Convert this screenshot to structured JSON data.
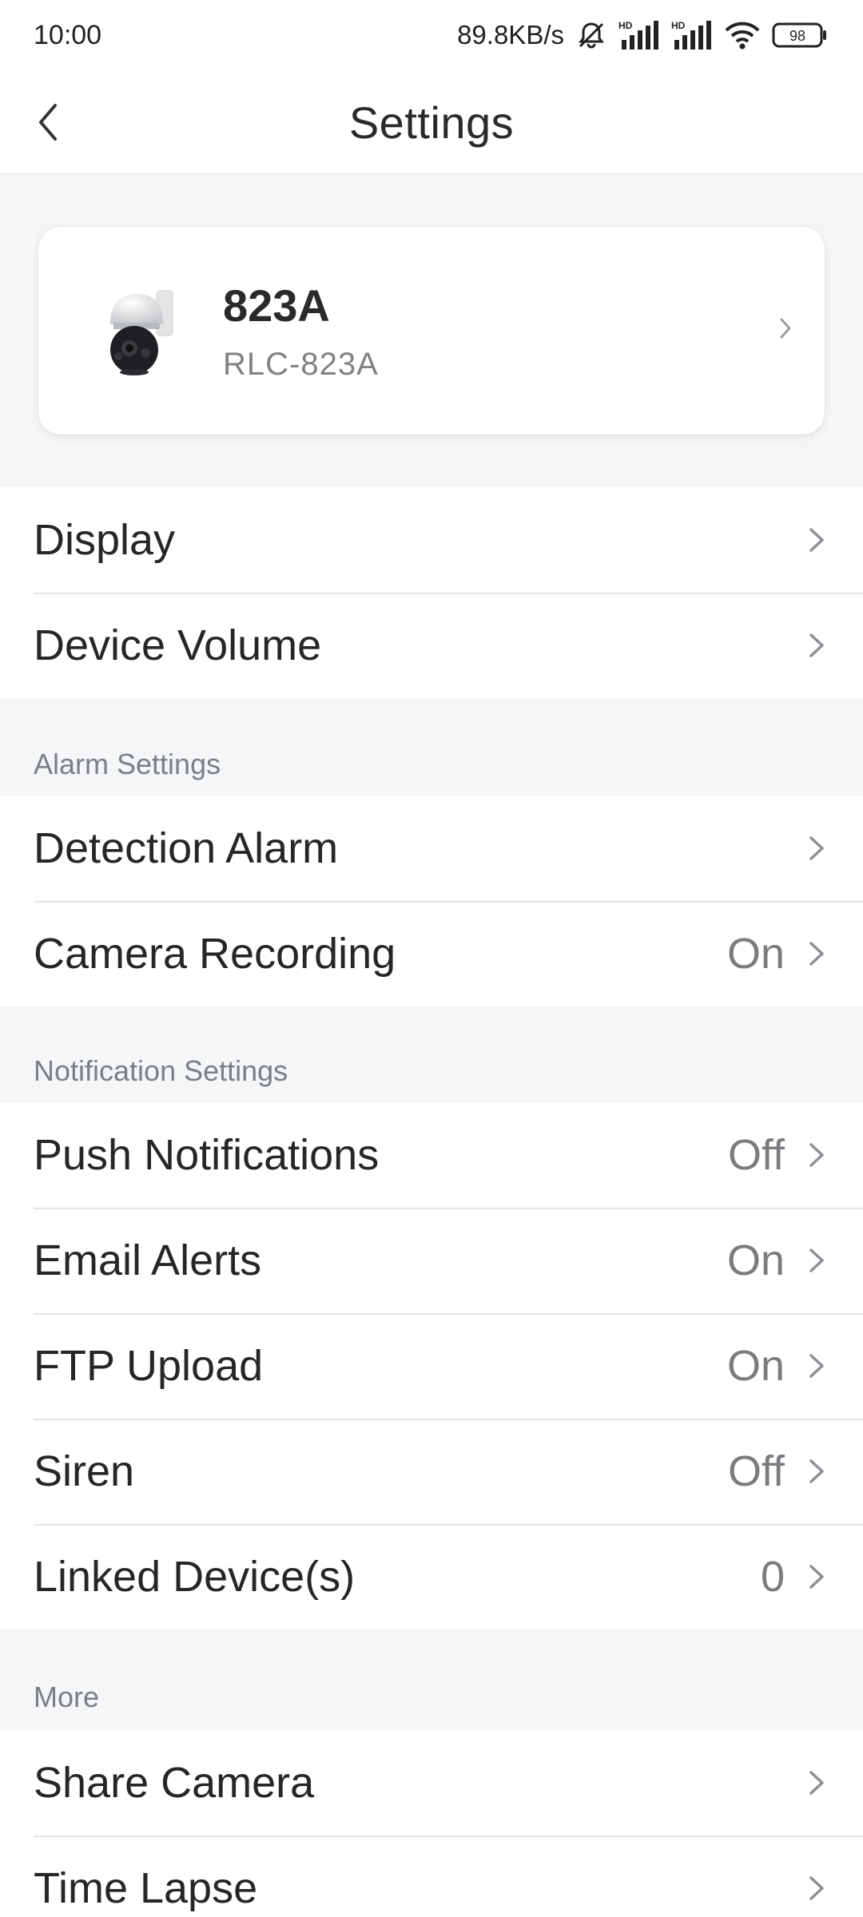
{
  "status_bar": {
    "time": "10:00",
    "net_speed": "89.8KB/s",
    "battery": "98",
    "icons": [
      "mute-bell-icon",
      "hd-signal-icon",
      "hd-signal-icon",
      "wifi-icon",
      "battery-icon"
    ]
  },
  "header": {
    "title": "Settings",
    "back_icon": "chevron-left-icon"
  },
  "device": {
    "name": "823A",
    "model": "RLC-823A",
    "image": "ptz-camera-image"
  },
  "general": [
    {
      "label": "Display",
      "value": ""
    },
    {
      "label": "Device Volume",
      "value": ""
    }
  ],
  "alarm": {
    "title": "Alarm Settings",
    "items": [
      {
        "label": "Detection Alarm",
        "value": ""
      },
      {
        "label": "Camera Recording",
        "value": "On"
      }
    ]
  },
  "notification": {
    "title": "Notification Settings",
    "items": [
      {
        "label": "Push Notifications",
        "value": "Off"
      },
      {
        "label": "Email Alerts",
        "value": "On"
      },
      {
        "label": "FTP Upload",
        "value": "On"
      },
      {
        "label": "Siren",
        "value": "Off"
      },
      {
        "label": "Linked Device(s)",
        "value": "0"
      }
    ]
  },
  "more": {
    "title": "More",
    "items": [
      {
        "label": "Share Camera",
        "value": ""
      },
      {
        "label": "Time Lapse",
        "value": ""
      }
    ]
  },
  "colors": {
    "background": "#f5f6f8",
    "surface": "#ffffff",
    "text": "#262626",
    "secondary_text": "#7a7c80",
    "divider": "#e3e4e7"
  }
}
